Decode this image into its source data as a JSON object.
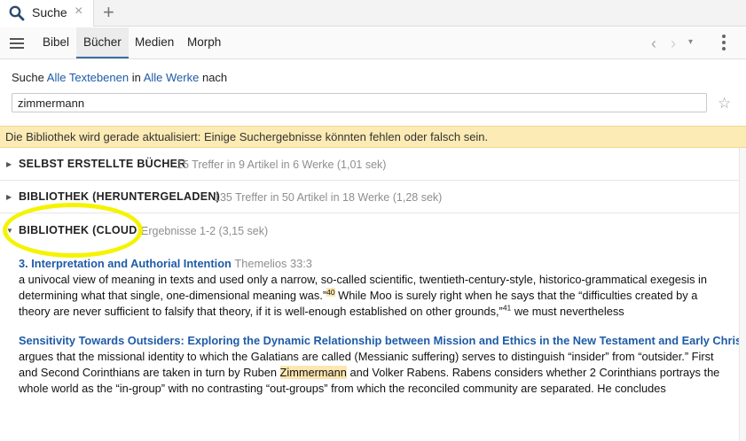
{
  "tab": {
    "label": "Suche",
    "close": "×",
    "new": "+"
  },
  "toolbar": {
    "items": [
      "Bibel",
      "Bücher",
      "Medien",
      "Morph"
    ],
    "active": "Bücher",
    "back": "‹",
    "forward": "›",
    "dropdown": "▾"
  },
  "search": {
    "prefix": "Suche",
    "scope_text": "Alle Textebenen",
    "in_word": "in",
    "works": "Alle Werke",
    "suffix": "nach",
    "query": "zimmermann",
    "favorite_icon": "☆"
  },
  "banner": "Die Bibliothek wird gerade aktualisiert: Einige Suchergebnisse könnten fehlen oder falsch sein.",
  "sections": [
    {
      "title": "SELBST ERSTELLTE BÜCHER",
      "meta": "15 Treffer in 9 Artikel in 6 Werke (1,01 sek)",
      "arrow": "▶"
    },
    {
      "title": "BIBLIOTHEK (HERUNTERGELADEN)",
      "meta": "135 Treffer in 50 Artikel in 18 Werke (1,28 sek)",
      "arrow": "▶"
    },
    {
      "title": "BIBLIOTHEK (CLOUD)",
      "meta": "Ergebnisse 1-2 (3,15 sek)",
      "arrow": "▼"
    }
  ],
  "results": [
    {
      "title": "3. Interpretation and Authorial Intention",
      "source": "Themelios 33:3",
      "line1": "a univocal view of meaning in texts and used only a narrow, so-called scientific, twentieth-century-style, historico-grammatical exegesis in",
      "line2a": "determining what that single, one-dimensional meaning was.”",
      "note1": "40",
      "line2b": " While Moo is surely right when he says that the “difficulties created by a",
      "line3a": "theory are never sufficient to falsify that theory, if it is well-enough established on other grounds,”",
      "note2": "41",
      "line3b": " we must nevertheless"
    },
    {
      "title": "Sensitivity Towards Outsiders: Exploring the Dynamic Relationship between Mission and Ethics in the New Testament and Early Christia",
      "line1": "argues that the missional identity to which the Galatians are called (Messianic suffering) serves to distinguish “insider” from “outsider.” First",
      "line2a": "and Second Corinthians are taken in turn by Ruben ",
      "highlight": "Zimmermann",
      "line2b": " and Volker Rabens. Rabens considers whether 2 Corinthians portrays the",
      "line3": "whole world as the “in-group” with no contrasting “out-groups” from which the reconciled community are separated. He concludes"
    }
  ],
  "colors": {
    "link": "#1e5ba8",
    "banner": "#fcebb4",
    "highlight": "#fde6b0",
    "annotation": "#f5f300"
  }
}
